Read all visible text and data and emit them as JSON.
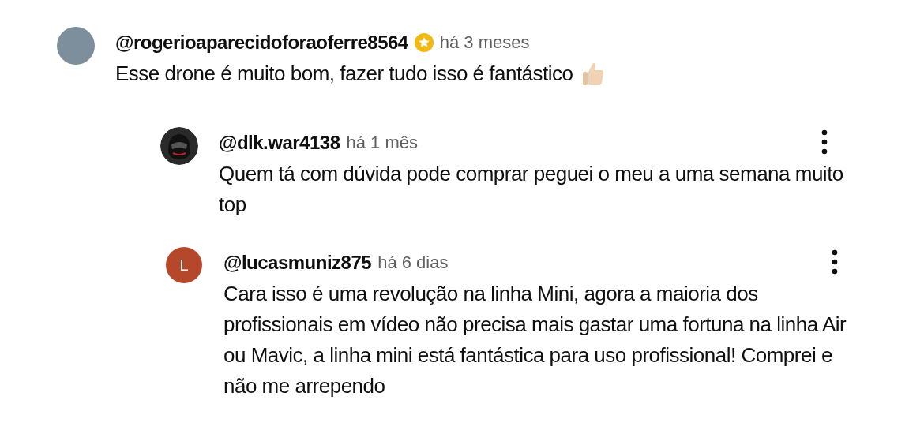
{
  "comments": [
    {
      "avatar": {
        "kind": "photo"
      },
      "author": "@rogerioaparecidoforaoferre8564",
      "badge": true,
      "time": "há 3 meses",
      "text": "Esse drone é muito bom, fazer tudo isso é fantástico",
      "thumbs_up": true,
      "menu": false,
      "reply": false
    },
    {
      "avatar": {
        "kind": "helmet"
      },
      "author": "@dlk.war4138",
      "badge": false,
      "time": "há 1 mês",
      "text": "Quem tá com dúvida pode comprar peguei o meu a uma semana muito top",
      "thumbs_up": false,
      "menu": true,
      "reply": true
    },
    {
      "avatar": {
        "kind": "letter",
        "letter": "L",
        "color": "#b5472a"
      },
      "author": "@lucasmuniz875",
      "badge": false,
      "time": "há 6 dias",
      "text": "Cara isso é uma revolução na linha Mini, agora a maioria dos profissionais em vídeo não precisa mais gastar uma fortuna na linha Air ou Mavic, a linha mini está fantástica para uso profissional! Comprei e não me arrependo",
      "thumbs_up": false,
      "menu": true,
      "reply": true
    }
  ]
}
